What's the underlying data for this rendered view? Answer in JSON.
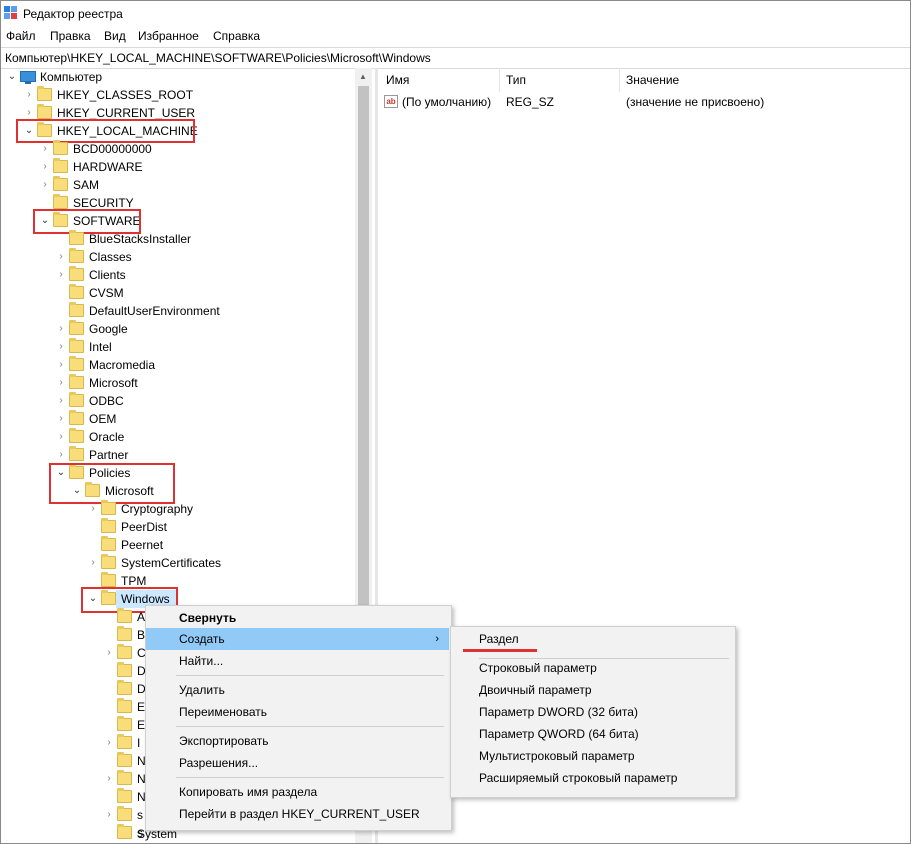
{
  "window": {
    "title": "Редактор реестра"
  },
  "menu": [
    "Файл",
    "Правка",
    "Вид",
    "Избранное",
    "Справка"
  ],
  "address": "Компьютер\\HKEY_LOCAL_MACHINE\\SOFTWARE\\Policies\\Microsoft\\Windows",
  "tree": {
    "root": "Компьютер",
    "hives": [
      "HKEY_CLASSES_ROOT",
      "HKEY_CURRENT_USER",
      "HKEY_LOCAL_MACHINE"
    ],
    "hklm_children": [
      "BCD00000000",
      "HARDWARE",
      "SAM",
      "SECURITY",
      "SOFTWARE"
    ],
    "software_children": [
      "BlueStacksInstaller",
      "Classes",
      "Clients",
      "CVSM",
      "DefaultUserEnvironment",
      "Google",
      "Intel",
      "Macromedia",
      "Microsoft",
      "ODBC",
      "OEM",
      "Oracle",
      "Partner",
      "Policies"
    ],
    "policies_children": [
      "Microsoft"
    ],
    "ms_children": [
      "Cryptography",
      "PeerDist",
      "Peernet",
      "SystemCertificates",
      "TPM",
      "Windows"
    ],
    "windows_children_partial": [
      "A",
      "B",
      "C",
      "D",
      "D",
      "E",
      "E",
      "I",
      "N",
      "N",
      "N",
      "s",
      "s"
    ],
    "last_visible": "System"
  },
  "list": {
    "columns": [
      "Имя",
      "Тип",
      "Значение"
    ],
    "rows": [
      {
        "name": "(По умолчанию)",
        "type": "REG_SZ",
        "value": "(значение не присвоено)"
      }
    ]
  },
  "context_menu": {
    "items": [
      "Свернуть",
      "Создать",
      "Найти...",
      "Удалить",
      "Переименовать",
      "Экспортировать",
      "Разрешения...",
      "Копировать имя раздела",
      "Перейти в раздел HKEY_CURRENT_USER"
    ],
    "submenu_arrow": "›"
  },
  "submenu": {
    "items": [
      "Раздел",
      "Строковый параметр",
      "Двоичный параметр",
      "Параметр DWORD (32 бита)",
      "Параметр QWORD (64 бита)",
      "Мультистроковый параметр",
      "Расширяемый строковый параметр"
    ]
  },
  "colors": {
    "highlight_box": "#e03131",
    "menu_highlight": "#91c9f7",
    "folder": "#f8dd7a"
  }
}
